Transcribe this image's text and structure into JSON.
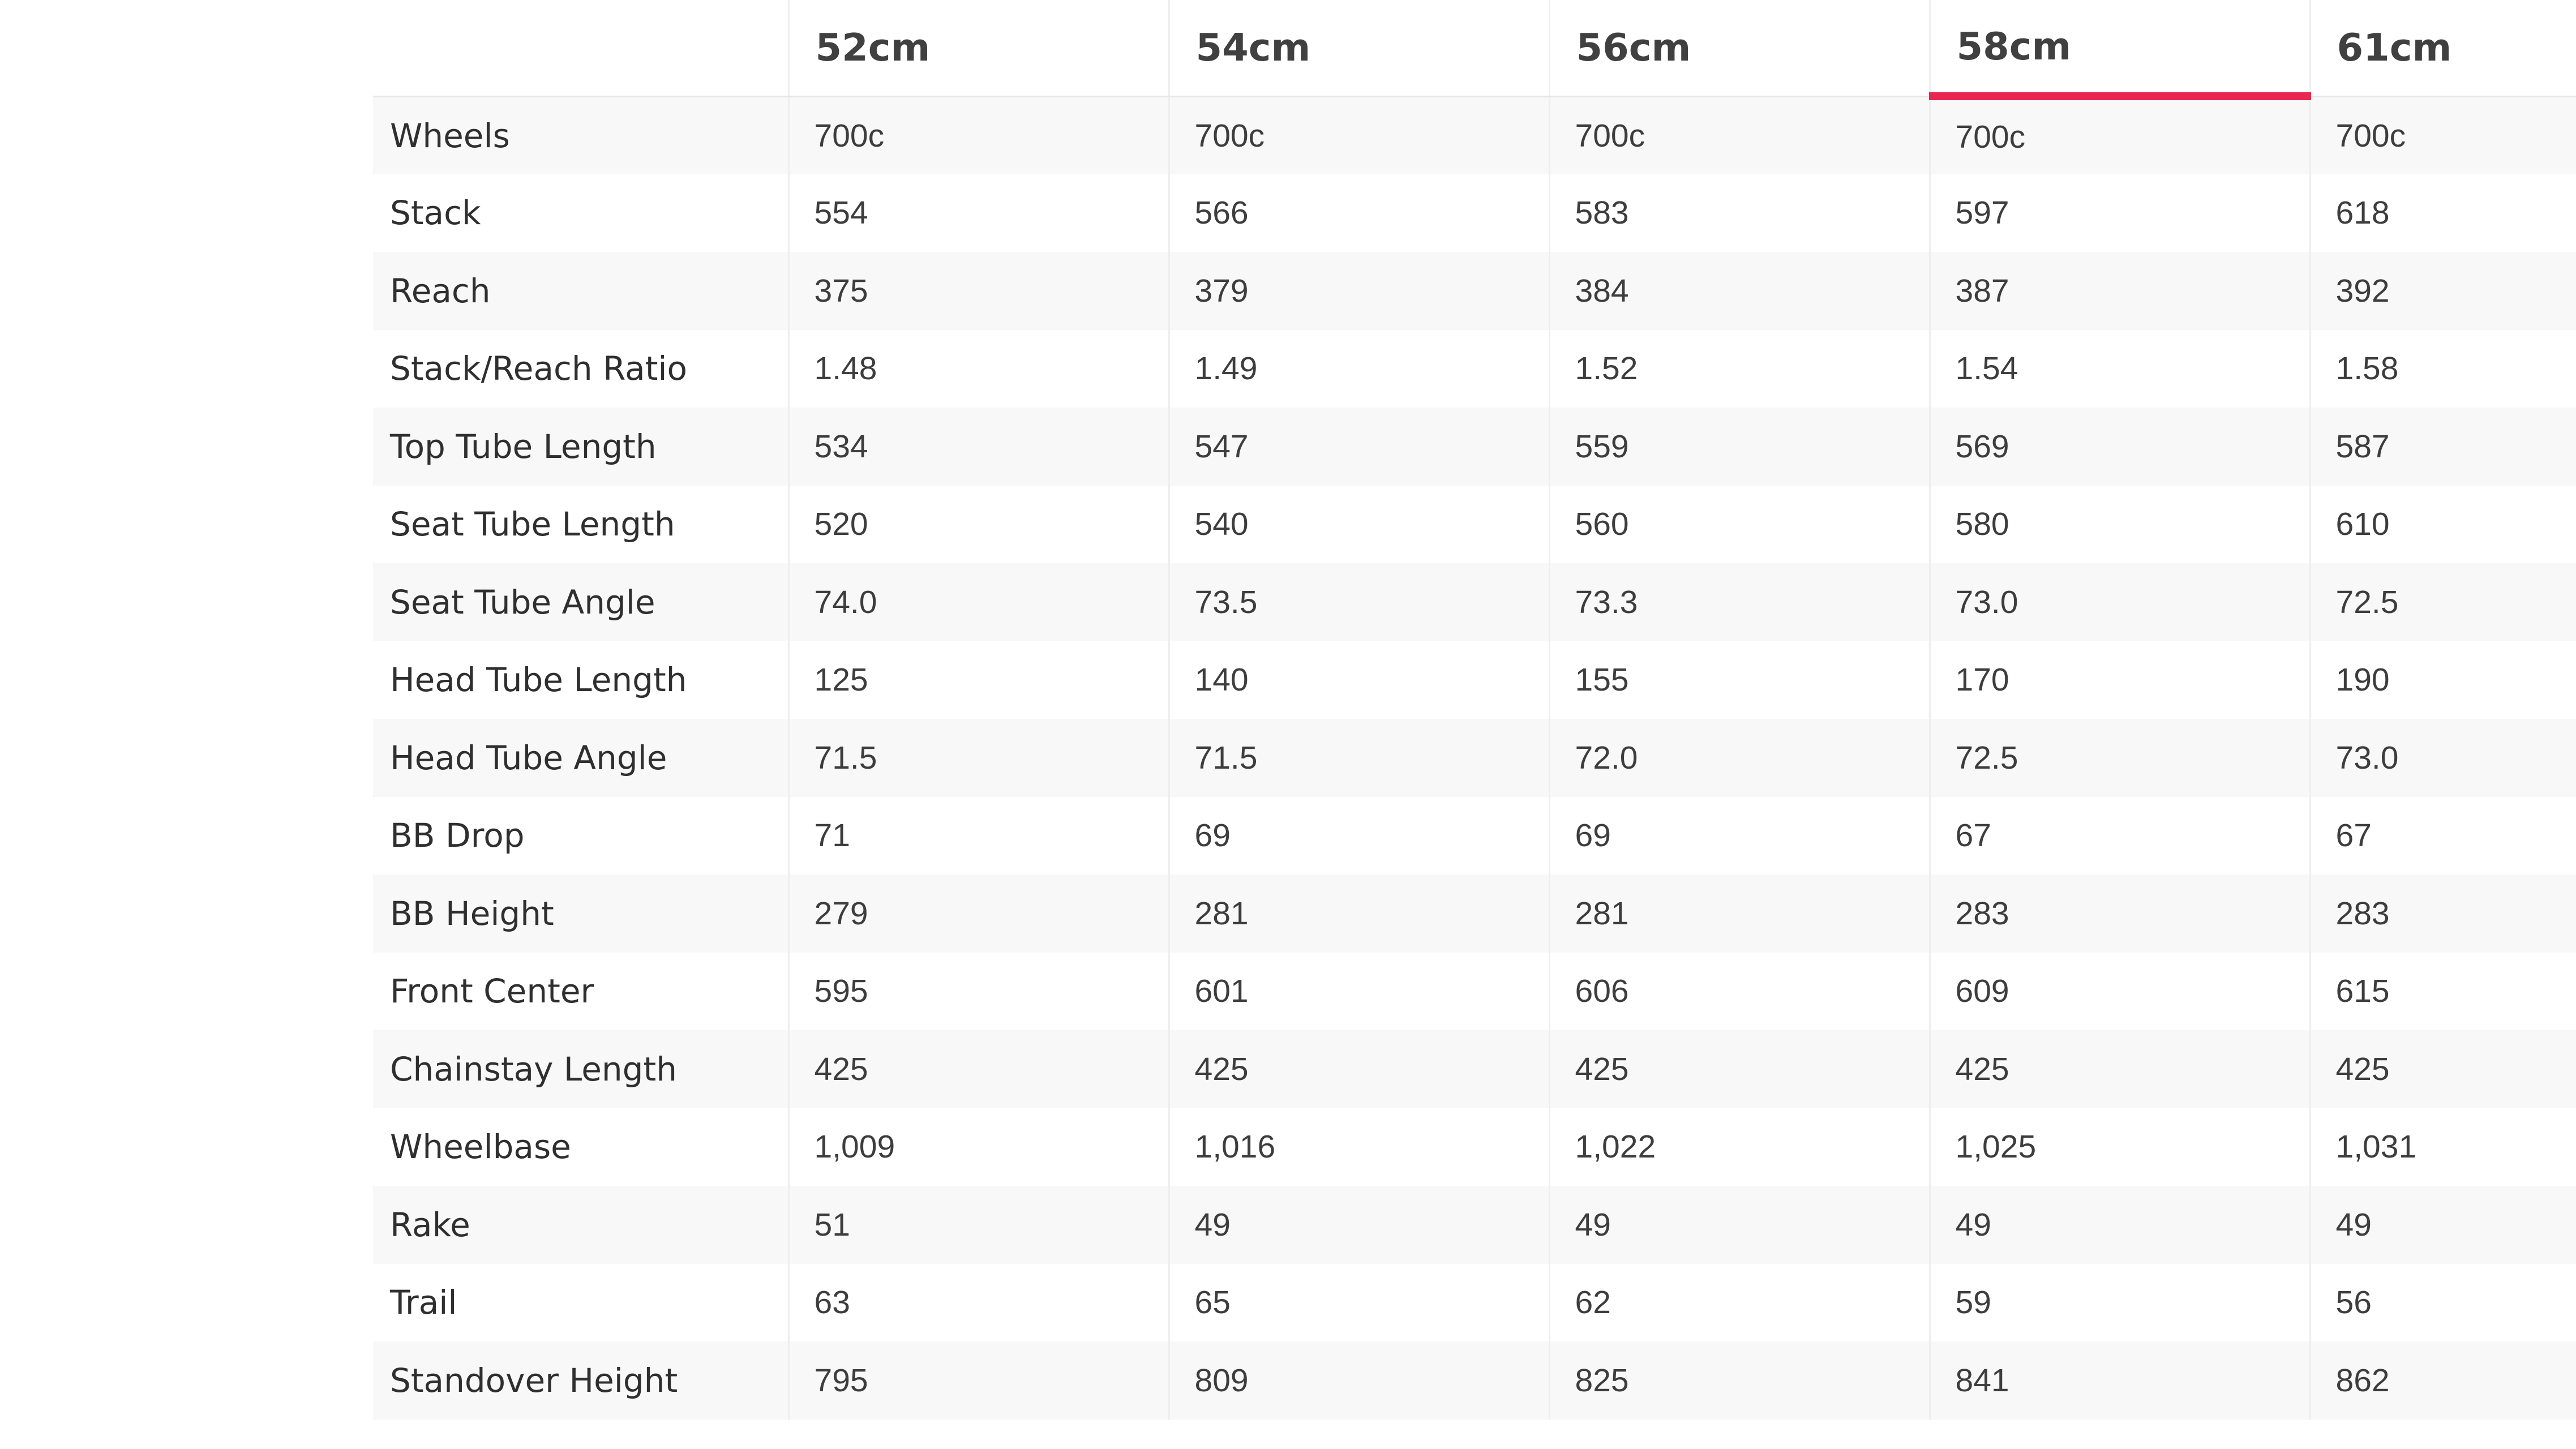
{
  "table": {
    "columns": [
      "",
      "52cm",
      "54cm",
      "56cm",
      "58cm",
      "61cm"
    ],
    "active_column": "58cm",
    "accent_color": "#e8264f",
    "rows": [
      {
        "label": "Wheels",
        "values": [
          "700c",
          "700c",
          "700c",
          "700c",
          "700c"
        ]
      },
      {
        "label": "Stack",
        "values": [
          "554",
          "566",
          "583",
          "597",
          "618"
        ]
      },
      {
        "label": "Reach",
        "values": [
          "375",
          "379",
          "384",
          "387",
          "392"
        ]
      },
      {
        "label": "Stack/Reach Ratio",
        "values": [
          "1.48",
          "1.49",
          "1.52",
          "1.54",
          "1.58"
        ]
      },
      {
        "label": "Top Tube Length",
        "values": [
          "534",
          "547",
          "559",
          "569",
          "587"
        ]
      },
      {
        "label": "Seat Tube Length",
        "values": [
          "520",
          "540",
          "560",
          "580",
          "610"
        ]
      },
      {
        "label": "Seat Tube Angle",
        "values": [
          "74.0",
          "73.5",
          "73.3",
          "73.0",
          "72.5"
        ]
      },
      {
        "label": "Head Tube Length",
        "values": [
          "125",
          "140",
          "155",
          "170",
          "190"
        ]
      },
      {
        "label": "Head Tube Angle",
        "values": [
          "71.5",
          "71.5",
          "72.0",
          "72.5",
          "73.0"
        ]
      },
      {
        "label": "BB Drop",
        "values": [
          "71",
          "69",
          "69",
          "67",
          "67"
        ]
      },
      {
        "label": "BB Height",
        "values": [
          "279",
          "281",
          "281",
          "283",
          "283"
        ]
      },
      {
        "label": "Front Center",
        "values": [
          "595",
          "601",
          "606",
          "609",
          "615"
        ]
      },
      {
        "label": "Chainstay Length",
        "values": [
          "425",
          "425",
          "425",
          "425",
          "425"
        ]
      },
      {
        "label": "Wheelbase",
        "values": [
          "1,009",
          "1,016",
          "1,022",
          "1,025",
          "1,031"
        ]
      },
      {
        "label": "Rake",
        "values": [
          "51",
          "49",
          "49",
          "49",
          "49"
        ]
      },
      {
        "label": "Trail",
        "values": [
          "63",
          "65",
          "62",
          "59",
          "56"
        ]
      },
      {
        "label": "Standover Height",
        "values": [
          "795",
          "809",
          "825",
          "841",
          "862"
        ]
      }
    ]
  }
}
